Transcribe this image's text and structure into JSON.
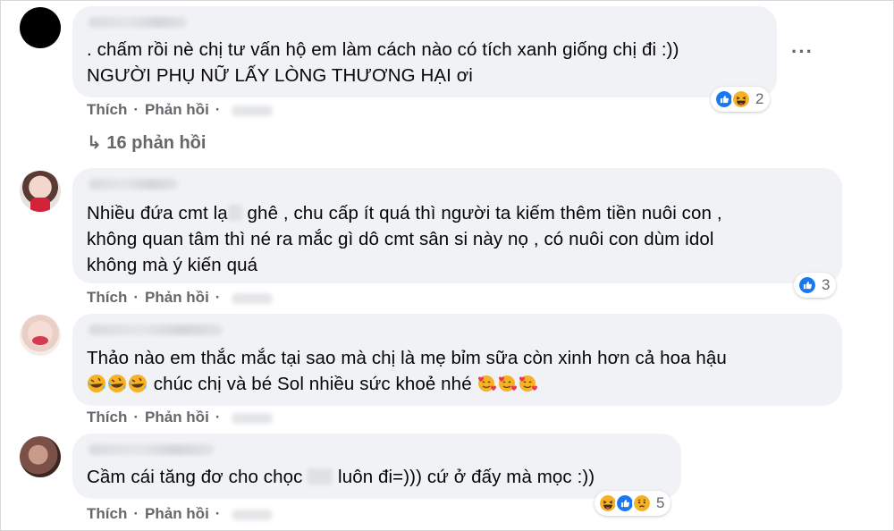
{
  "comments": [
    {
      "text_lines": [
        ". chấm rồi nè chị tư vấn hộ em làm cách nào có tích xanh giống chị đi :))",
        "NGƯỜI PHỤ NỮ LẤY LÒNG THƯƠNG HẠI ơi"
      ],
      "like_label": "Thích",
      "reply_label": "Phản hồi",
      "reaction_count": "2",
      "reaction_icons": [
        "like-icon",
        "laugh-icon"
      ],
      "more_label": "···",
      "replies_label": "16 phản hồi"
    },
    {
      "text_lines_pre": "Nhiều đứa cmt lạ",
      "text_lines_post": " ghê , chu cấp ít quá thì người ta kiếm thêm tiền nuôi con ,",
      "text_line2": "không quan tâm thì né ra mắc gì dô cmt sân si này nọ , có nuôi con dùm idol",
      "text_line3": "không mà ý kiến quá",
      "like_label": "Thích",
      "reply_label": "Phản hồi",
      "reaction_count": "3",
      "reaction_icons": [
        "like-icon"
      ]
    },
    {
      "text_line1": "Thảo nào em thắc mắc tại sao mà chị là mẹ bỉm sữa còn xinh hơn cả hoa hậu",
      "text_line2": " chúc chị và bé Sol nhiều sức khoẻ nhé ",
      "line2_leading_emojis": [
        "rofl-icon",
        "rofl-icon",
        "rofl-icon"
      ],
      "line2_trailing_emojis": [
        "smiling-hearts-icon",
        "smiling-hearts-icon",
        "smiling-hearts-icon"
      ],
      "like_label": "Thích",
      "reply_label": "Phản hồi"
    },
    {
      "text_pre": "Cầm cái tăng đơ cho chọc ",
      "text_post": " luôn đi=))) cứ ở đấy mà mọc :))",
      "like_label": "Thích",
      "reply_label": "Phản hồi",
      "reaction_count": "5",
      "reaction_icons": [
        "laugh-icon",
        "like-icon",
        "sad-icon"
      ]
    }
  ],
  "colors": {
    "bubble": "#f0f2f5",
    "secondary_text": "#65676b",
    "like_blue": "#1877f2",
    "emoji_yellow": "#f7b125"
  }
}
